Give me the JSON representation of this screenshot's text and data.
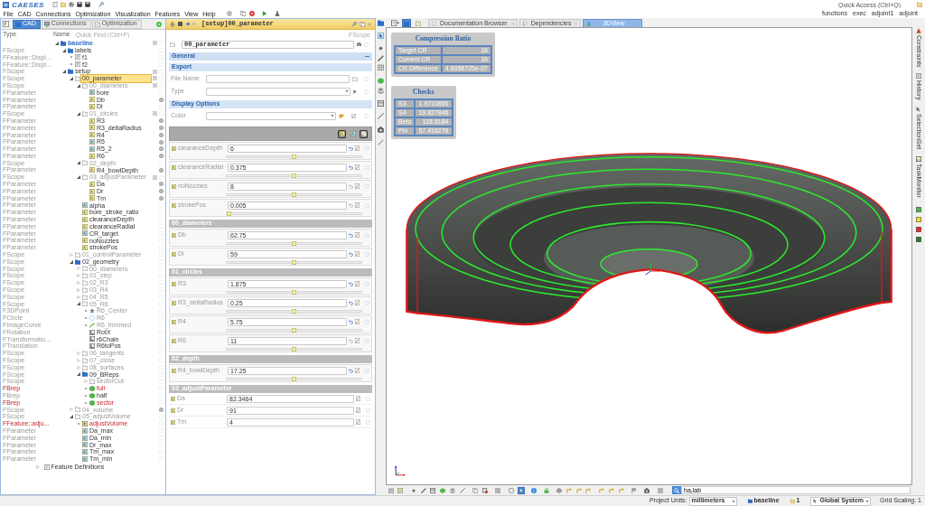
{
  "app": {
    "logo": "CAESES",
    "quick_access": {
      "placeholder": "Quick Access (Ctrl+Q)"
    }
  },
  "menu": [
    "File",
    "CAD",
    "Connections",
    "Optimization",
    "Visualization",
    "Features",
    "View",
    "Help"
  ],
  "toolbar_labels": [
    "functions",
    "exec",
    "adjoint1",
    "adjoint"
  ],
  "left_panel": {
    "tabs": [
      {
        "label": "CAD",
        "selected": true
      },
      {
        "label": "Connections",
        "selected": false
      },
      {
        "label": "Optimization",
        "selected": false
      }
    ],
    "columns": [
      "Type",
      "Name"
    ],
    "search": {
      "placeholder": "Quick Find (Ctrl+F)"
    },
    "tree": [
      {
        "name": "baseline",
        "kind": "folder",
        "expanded": true,
        "selected": false,
        "muted": false,
        "error": false,
        "tag": true,
        "note": false,
        "children": [
          {
            "type": "FScope",
            "name": "labels",
            "kind": "folder",
            "expanded": true,
            "selected": false,
            "muted": false,
            "error": false,
            "tag": false,
            "note": false,
            "children": [
              {
                "type": "FFeature::Displ...",
                "name": "f1",
                "kind": "label",
                "selected": false,
                "muted": false,
                "error": false,
                "tag": false,
                "note": false
              },
              {
                "type": "FFeature::Displ...",
                "name": "f2",
                "kind": "label",
                "selected": false,
                "muted": false,
                "error": false,
                "tag": false,
                "note": false
              }
            ]
          },
          {
            "type": "FScope",
            "name": "setup",
            "kind": "folder",
            "expanded": true,
            "selected": false,
            "muted": false,
            "error": false,
            "tag": true,
            "note": false,
            "children": [
              {
                "type": "FScope",
                "name": "00_parameter",
                "kind": "scope",
                "expanded": true,
                "selected": true,
                "muted": false,
                "error": false,
                "tag": true,
                "note": false,
                "children": [
                  {
                    "type": "FScope",
                    "name": "00_diameters",
                    "kind": "scope",
                    "expanded": true,
                    "selected": false,
                    "muted": true,
                    "error": false,
                    "tag": true,
                    "note": false,
                    "children": [
                      {
                        "type": "FParameter",
                        "name": "bore",
                        "kind": "parameter",
                        "selected": false,
                        "muted": false,
                        "error": false,
                        "tag": false,
                        "note": false
                      },
                      {
                        "type": "FParameter",
                        "name": "Db",
                        "kind": "variable",
                        "selected": false,
                        "muted": false,
                        "error": false,
                        "tag": false,
                        "note": true
                      },
                      {
                        "type": "FParameter",
                        "name": "Di",
                        "kind": "variable",
                        "selected": false,
                        "muted": false,
                        "error": false,
                        "tag": false,
                        "note": false
                      }
                    ]
                  },
                  {
                    "type": "FScope",
                    "name": "01_circles",
                    "kind": "scope",
                    "expanded": true,
                    "selected": false,
                    "muted": true,
                    "error": false,
                    "tag": true,
                    "note": false,
                    "children": [
                      {
                        "type": "FParameter",
                        "name": "R3",
                        "kind": "variable",
                        "selected": false,
                        "muted": false,
                        "error": false,
                        "tag": false,
                        "note": true
                      },
                      {
                        "type": "FParameter",
                        "name": "R3_deltaRadius",
                        "kind": "variable",
                        "selected": false,
                        "muted": false,
                        "error": false,
                        "tag": false,
                        "note": true
                      },
                      {
                        "type": "FParameter",
                        "name": "R4",
                        "kind": "variable",
                        "selected": false,
                        "muted": false,
                        "error": false,
                        "tag": false,
                        "note": true
                      },
                      {
                        "type": "FParameter",
                        "name": "R5",
                        "kind": "parameter",
                        "selected": false,
                        "muted": false,
                        "error": false,
                        "tag": false,
                        "note": true
                      },
                      {
                        "type": "FParameter",
                        "name": "R5_2",
                        "kind": "parameter",
                        "selected": false,
                        "muted": false,
                        "error": false,
                        "tag": false,
                        "note": true
                      },
                      {
                        "type": "FParameter",
                        "name": "R6",
                        "kind": "variable",
                        "selected": false,
                        "muted": false,
                        "error": false,
                        "tag": false,
                        "note": true
                      }
                    ]
                  },
                  {
                    "type": "FScope",
                    "name": "02_depth",
                    "kind": "scope",
                    "expanded": true,
                    "selected": false,
                    "muted": true,
                    "error": false,
                    "tag": false,
                    "note": false,
                    "children": [
                      {
                        "type": "FParameter",
                        "name": "R4_bowlDepth",
                        "kind": "variable",
                        "selected": false,
                        "muted": false,
                        "error": false,
                        "tag": false,
                        "note": true
                      }
                    ]
                  },
                  {
                    "type": "FScope",
                    "name": "03_adjustParameter",
                    "kind": "scope",
                    "expanded": true,
                    "selected": false,
                    "muted": true,
                    "error": false,
                    "tag": true,
                    "note": false,
                    "children": [
                      {
                        "type": "FParameter",
                        "name": "Da",
                        "kind": "variable",
                        "selected": false,
                        "muted": false,
                        "error": false,
                        "tag": false,
                        "note": true
                      },
                      {
                        "type": "FParameter",
                        "name": "Dr",
                        "kind": "variable",
                        "selected": false,
                        "muted": false,
                        "error": false,
                        "tag": false,
                        "note": true
                      },
                      {
                        "type": "FParameter",
                        "name": "Tm",
                        "kind": "variable",
                        "selected": false,
                        "muted": false,
                        "error": false,
                        "tag": false,
                        "note": true
                      }
                    ]
                  },
                  {
                    "type": "FParameter",
                    "name": "alpha",
                    "kind": "parameter",
                    "selected": false,
                    "muted": false,
                    "error": false,
                    "tag": false,
                    "note": false
                  },
                  {
                    "type": "FParameter",
                    "name": "bore_stroke_ratio",
                    "kind": "variable",
                    "selected": false,
                    "muted": false,
                    "error": false,
                    "tag": false,
                    "note": false
                  },
                  {
                    "type": "FParameter",
                    "name": "clearanceDepth",
                    "kind": "variable",
                    "selected": false,
                    "muted": false,
                    "error": false,
                    "tag": false,
                    "note": false
                  },
                  {
                    "type": "FParameter",
                    "name": "clearanceRadial",
                    "kind": "variable",
                    "selected": false,
                    "muted": false,
                    "error": false,
                    "tag": false,
                    "note": false
                  },
                  {
                    "type": "FParameter",
                    "name": "CR_target",
                    "kind": "parameter",
                    "selected": false,
                    "muted": false,
                    "error": false,
                    "tag": false,
                    "note": false
                  },
                  {
                    "type": "FParameter",
                    "name": "noNozzles",
                    "kind": "variable",
                    "selected": false,
                    "muted": false,
                    "error": false,
                    "tag": false,
                    "note": false
                  },
                  {
                    "type": "FParameter",
                    "name": "strokePos",
                    "kind": "variable",
                    "selected": false,
                    "muted": false,
                    "error": false,
                    "tag": false,
                    "note": false
                  }
                ]
              },
              {
                "type": "FScope",
                "name": "01_controlParameter",
                "kind": "scope",
                "expanded": false,
                "selected": false,
                "muted": true,
                "error": false,
                "tag": false,
                "note": false
              },
              {
                "type": "FScope",
                "name": "02_geometry",
                "kind": "folder",
                "expanded": true,
                "selected": false,
                "muted": false,
                "error": false,
                "tag": false,
                "note": false,
                "children": [
                  {
                    "type": "FScope",
                    "name": "00_diameters",
                    "kind": "scope",
                    "expanded": false,
                    "selected": false,
                    "muted": true,
                    "error": false,
                    "tag": false,
                    "note": false
                  },
                  {
                    "type": "FScope",
                    "name": "01_step",
                    "kind": "scope",
                    "expanded": false,
                    "selected": false,
                    "muted": true,
                    "error": false,
                    "tag": false,
                    "note": false
                  },
                  {
                    "type": "FScope",
                    "name": "02_R3",
                    "kind": "scope",
                    "expanded": false,
                    "selected": false,
                    "muted": true,
                    "error": false,
                    "tag": false,
                    "note": false
                  },
                  {
                    "type": "FScope",
                    "name": "03_R4",
                    "kind": "scope",
                    "expanded": false,
                    "selected": false,
                    "muted": true,
                    "error": false,
                    "tag": false,
                    "note": false
                  },
                  {
                    "type": "FScope",
                    "name": "04_R5",
                    "kind": "scope",
                    "expanded": false,
                    "selected": false,
                    "muted": true,
                    "error": false,
                    "tag": false,
                    "note": false
                  },
                  {
                    "type": "FScope",
                    "name": "05_R6",
                    "kind": "scope",
                    "expanded": true,
                    "selected": false,
                    "muted": true,
                    "error": false,
                    "tag": false,
                    "note": false,
                    "children": [
                      {
                        "type": "F3DPoint",
                        "name": "R6_Center",
                        "kind": "point",
                        "selected": false,
                        "muted": true,
                        "error": false,
                        "tag": false,
                        "note": false
                      },
                      {
                        "type": "FCircle",
                        "name": "R6",
                        "kind": "circle",
                        "selected": false,
                        "muted": true,
                        "error": false,
                        "tag": false,
                        "note": false
                      },
                      {
                        "type": "FImageCurve",
                        "name": "R6_trimmed",
                        "kind": "curve",
                        "selected": false,
                        "muted": true,
                        "error": false,
                        "tag": false,
                        "note": false
                      },
                      {
                        "type": "FRotation",
                        "name": "RotX",
                        "kind": "transform",
                        "selected": false,
                        "muted": false,
                        "error": false,
                        "tag": false,
                        "note": false
                      },
                      {
                        "type": "FTransformatio...",
                        "name": "r6Chain",
                        "kind": "transform",
                        "selected": false,
                        "muted": false,
                        "error": false,
                        "tag": false,
                        "note": false
                      },
                      {
                        "type": "FTranslation",
                        "name": "R6toPos",
                        "kind": "transform",
                        "selected": false,
                        "muted": false,
                        "error": false,
                        "tag": false,
                        "note": false
                      }
                    ]
                  },
                  {
                    "type": "FScope",
                    "name": "06_tangents",
                    "kind": "scope",
                    "expanded": false,
                    "selected": false,
                    "muted": true,
                    "error": false,
                    "tag": false,
                    "note": false
                  },
                  {
                    "type": "FScope",
                    "name": "07_close",
                    "kind": "scope",
                    "expanded": false,
                    "selected": false,
                    "muted": true,
                    "error": false,
                    "tag": false,
                    "note": false
                  },
                  {
                    "type": "FScope",
                    "name": "08_surfaces",
                    "kind": "scope",
                    "expanded": false,
                    "selected": false,
                    "muted": true,
                    "error": false,
                    "tag": false,
                    "note": false
                  },
                  {
                    "type": "FScope",
                    "name": "09_BReps",
                    "kind": "folder",
                    "expanded": true,
                    "selected": false,
                    "muted": false,
                    "error": false,
                    "tag": false,
                    "note": false,
                    "children": [
                      {
                        "type": "FScope",
                        "name": "sectorCut",
                        "kind": "scope",
                        "expanded": false,
                        "selected": false,
                        "muted": true,
                        "error": false,
                        "tag": false,
                        "note": false
                      },
                      {
                        "type": "FBrep",
                        "name": "full",
                        "kind": "brep",
                        "selected": false,
                        "muted": false,
                        "error": true,
                        "tag": false,
                        "note": false
                      },
                      {
                        "type": "FBrep",
                        "name": "half",
                        "kind": "brep",
                        "selected": false,
                        "muted": false,
                        "error": false,
                        "tag": false,
                        "note": false
                      },
                      {
                        "type": "FBrep",
                        "name": "sector",
                        "kind": "brep",
                        "selected": false,
                        "muted": false,
                        "error": true,
                        "tag": false,
                        "note": false
                      }
                    ]
                  }
                ]
              },
              {
                "type": "FScope",
                "name": "04_volume",
                "kind": "scope",
                "expanded": false,
                "selected": false,
                "muted": true,
                "error": false,
                "tag": false,
                "note": true
              },
              {
                "type": "FScope",
                "name": "05_adjustVolume",
                "kind": "scope",
                "expanded": true,
                "selected": false,
                "muted": true,
                "error": false,
                "tag": false,
                "note": false,
                "children": [
                  {
                    "type": "FFeature::adju...",
                    "name": "adjustVolume",
                    "kind": "feature",
                    "selected": false,
                    "muted": false,
                    "error": true,
                    "tag": false,
                    "note": false
                  },
                  {
                    "type": "FParameter",
                    "name": "Da_max",
                    "kind": "parameter",
                    "selected": false,
                    "muted": false,
                    "error": false,
                    "tag": false,
                    "note": false
                  },
                  {
                    "type": "FParameter",
                    "name": "Da_min",
                    "kind": "parameter",
                    "selected": false,
                    "muted": false,
                    "error": false,
                    "tag": false,
                    "note": false
                  },
                  {
                    "type": "FParameter",
                    "name": "Dr_max",
                    "kind": "parameter",
                    "selected": false,
                    "muted": false,
                    "error": false,
                    "tag": false,
                    "note": false
                  },
                  {
                    "type": "FParameter",
                    "name": "Tm_max",
                    "kind": "parameter",
                    "selected": false,
                    "muted": false,
                    "error": false,
                    "tag": false,
                    "note": false
                  },
                  {
                    "type": "FParameter",
                    "name": "Tm_min",
                    "kind": "parameter",
                    "selected": false,
                    "muted": false,
                    "error": false,
                    "tag": false,
                    "note": false
                  }
                ]
              }
            ]
          }
        ]
      }
    ],
    "footer": {
      "label": "Feature Definitions",
      "expanded": false
    }
  },
  "editor": {
    "title": "[setup]00_parameter",
    "object_type": "FScope",
    "name": "00_parameter",
    "general": {
      "title": "General",
      "expanded": true
    },
    "subsections": [
      {
        "title": "Export",
        "fields": [
          {
            "label": "File Name",
            "kind": "file"
          },
          {
            "label": "Type",
            "kind": "select"
          }
        ]
      },
      {
        "title": "Display Options",
        "fields": [
          {
            "label": "Color",
            "kind": "color"
          }
        ]
      }
    ],
    "filters": [
      {
        "kind": "variable",
        "on": true
      },
      {
        "kind": "parameter",
        "on": false
      },
      {
        "kind": "edit",
        "on": true
      }
    ],
    "groups": [
      {
        "parameters": [
          {
            "name": "clearanceDepth",
            "value": "6",
            "modified": true,
            "level": 0.5
          },
          {
            "name": "clearanceRadial",
            "value": "0.375",
            "modified": true,
            "level": 0.5
          },
          {
            "name": "noNozzles",
            "value": "8",
            "modified": false,
            "level": 0.5
          },
          {
            "name": "strokePos",
            "value": "0.005",
            "modified": false,
            "level": 0.0
          }
        ]
      },
      {
        "title": "00_diameters",
        "parameters": [
          {
            "name": "Db",
            "value": "62.75",
            "modified": true,
            "level": 0.5
          },
          {
            "name": "Di",
            "value": "59",
            "modified": true,
            "level": 0.5
          }
        ]
      },
      {
        "title": "01_circles",
        "parameters": [
          {
            "name": "R3",
            "value": "1.875",
            "modified": true,
            "level": 0.5
          },
          {
            "name": "R3_deltaRadius",
            "value": "0.25",
            "modified": true,
            "level": 0.5
          },
          {
            "name": "R4",
            "value": "5.75",
            "modified": true,
            "level": 0.5
          },
          {
            "name": "R6",
            "value": "11",
            "modified": false,
            "level": 0.5
          }
        ]
      },
      {
        "title": "02_depth",
        "parameters": [
          {
            "name": "R4_bowlDepth",
            "value": "17.25",
            "modified": true,
            "level": 0.5
          }
        ]
      },
      {
        "title": "03_adjustParameter",
        "parameters": [
          {
            "name": "Da",
            "value": "82.3464"
          },
          {
            "name": "Dr",
            "value": "91"
          },
          {
            "name": "Tm",
            "value": "4"
          }
        ]
      }
    ]
  },
  "view": {
    "panel_toggles": [
      {
        "on": true
      },
      {
        "on": false
      }
    ],
    "tabs": [
      {
        "label": "Documentation Browser",
        "kind": "browser",
        "selected": false
      },
      {
        "label": "Dependencies",
        "kind": "graph",
        "selected": false
      },
      {
        "label": "3DView",
        "kind": "view",
        "selected": true
      }
    ],
    "overlays": [
      {
        "title": "Compression Ratio",
        "rows": [
          [
            "Target CR",
            "16"
          ],
          [
            "Current CR",
            "16"
          ],
          [
            "CR Difference",
            "4.8058725e-07"
          ]
        ]
      },
      {
        "title": "Checks",
        "rows": [
          [
            "S3",
            "1.9710885"
          ],
          [
            "S4",
            "19.827846"
          ],
          [
            "Beta",
            "118.6184"
          ],
          [
            "Phi",
            "57.416276"
          ]
        ]
      }
    ],
    "tool_toggles": [
      {
        "on": false
      },
      {
        "on": true
      }
    ],
    "command": {
      "value": "ha,lab"
    }
  },
  "side_tabs": [
    "Constraints",
    "History",
    "SelectionSet",
    "TaskMonitor"
  ],
  "status_bar": {
    "units_label": "Project Units:",
    "units": "millimeters",
    "design": "baseline",
    "design_count": "1",
    "coordinate_system": "Global System",
    "grid_scaling": "Grid Scaling: 1"
  }
}
